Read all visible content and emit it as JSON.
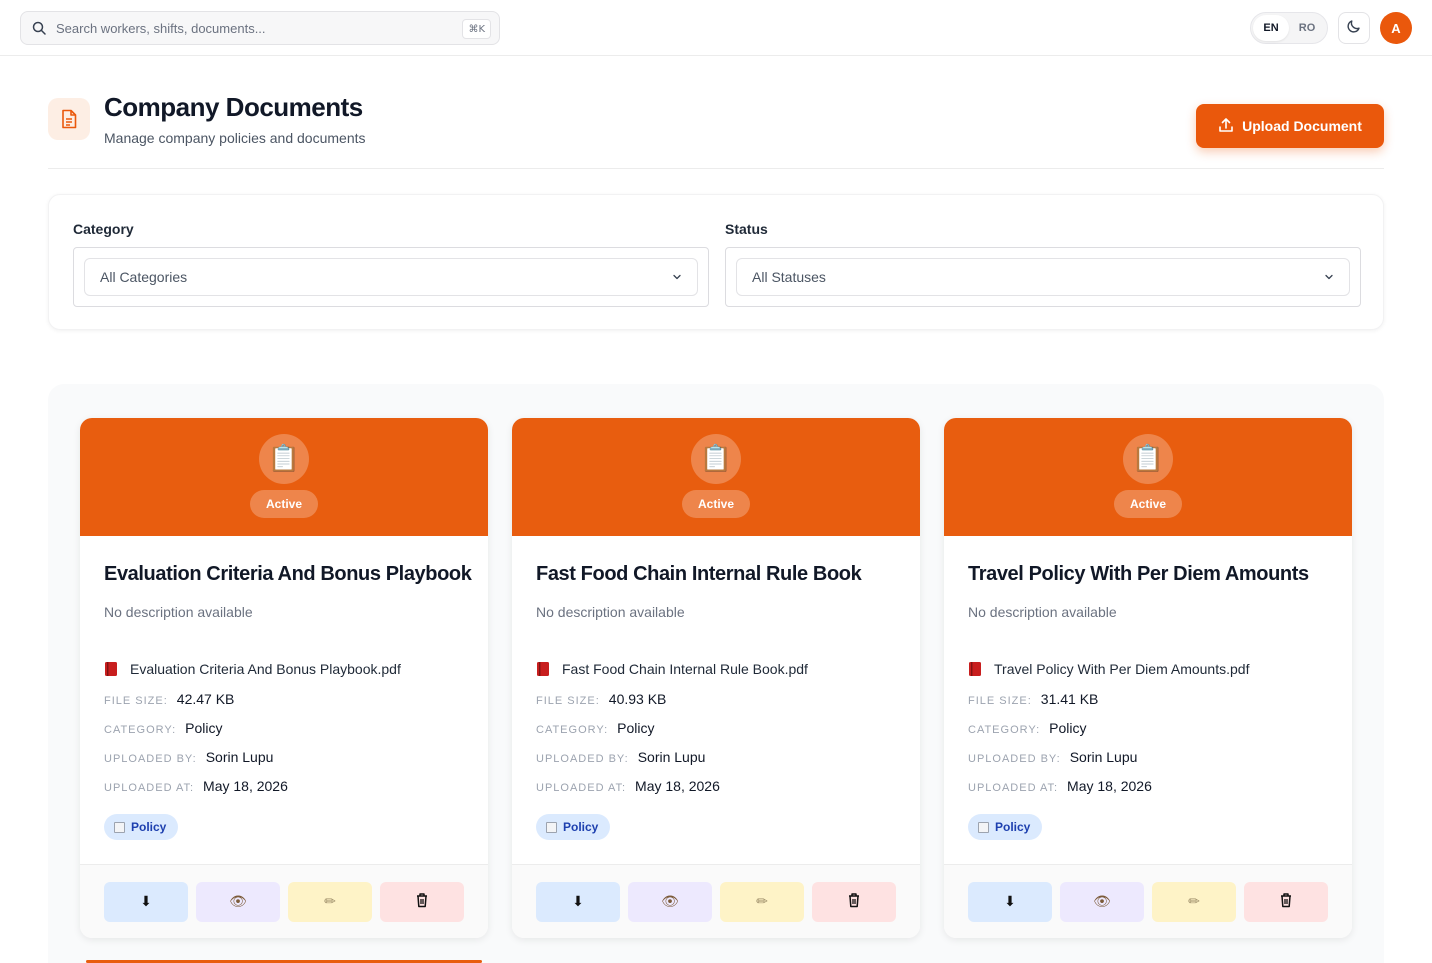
{
  "topbar": {
    "search_placeholder": "Search workers, shifts, documents...",
    "search_shortcut": "⌘K",
    "languages": [
      "EN",
      "RO"
    ],
    "active_language": "EN",
    "avatar_initial": "A"
  },
  "header": {
    "title": "Company Documents",
    "subtitle": "Manage company policies and documents",
    "upload_label": "Upload Document"
  },
  "filters": {
    "category_label": "Category",
    "category_value": "All Categories",
    "status_label": "Status",
    "status_value": "All Statuses"
  },
  "labels": {
    "file_size": "FILE SIZE:",
    "category": "CATEGORY:",
    "uploaded_by": "UPLOADED BY:",
    "uploaded_at": "UPLOADED AT:"
  },
  "documents": [
    {
      "status": "Active",
      "title": "Evaluation Criteria And Bonus Playbook",
      "description": "No description available",
      "file_name": "Evaluation Criteria And Bonus Playbook.pdf",
      "file_size": "42.47 KB",
      "category": "Policy",
      "uploaded_by": "Sorin Lupu",
      "uploaded_at": "May 18, 2026",
      "tag": "Policy"
    },
    {
      "status": "Active",
      "title": "Fast Food Chain Internal Rule Book",
      "description": "No description available",
      "file_name": "Fast Food Chain Internal Rule Book.pdf",
      "file_size": "40.93 KB",
      "category": "Policy",
      "uploaded_by": "Sorin Lupu",
      "uploaded_at": "May 18, 2026",
      "tag": "Policy"
    },
    {
      "status": "Active",
      "title": "Travel Policy With Per Diem Amounts",
      "description": "No description available",
      "file_name": "Travel Policy With Per Diem Amounts.pdf",
      "file_size": "31.41 KB",
      "category": "Policy",
      "uploaded_by": "Sorin Lupu",
      "uploaded_at": "May 18, 2026",
      "tag": "Policy"
    }
  ],
  "icons": {
    "card_header": "clipboard-icon",
    "file": "book-icon",
    "download": "download-icon",
    "view": "eye-icon",
    "edit": "pencil-icon",
    "delete": "trash-icon"
  },
  "colors": {
    "accent": "#ea580c",
    "card_header": "#e85d0f",
    "tag_bg": "#dbeafe",
    "tag_text": "#1e40af"
  }
}
